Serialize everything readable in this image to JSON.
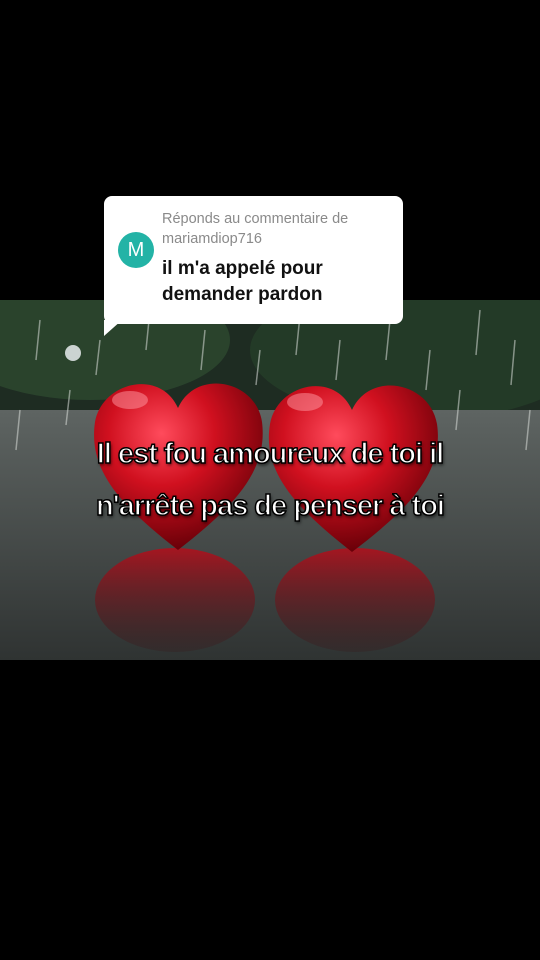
{
  "comment_card": {
    "reply_prefix": "Réponds au commentaire de",
    "username": "mariamdiop716",
    "avatar_initial": "M",
    "comment_text": "il m'a appelé pour demander pardon",
    "avatar_color": "#23b3a6"
  },
  "video": {
    "caption_line1": "Il est fou amoureux de toi il",
    "caption_line2": "n'arrête pas de penser à toi",
    "scene_subject": "two-red-hearts-in-rain"
  }
}
